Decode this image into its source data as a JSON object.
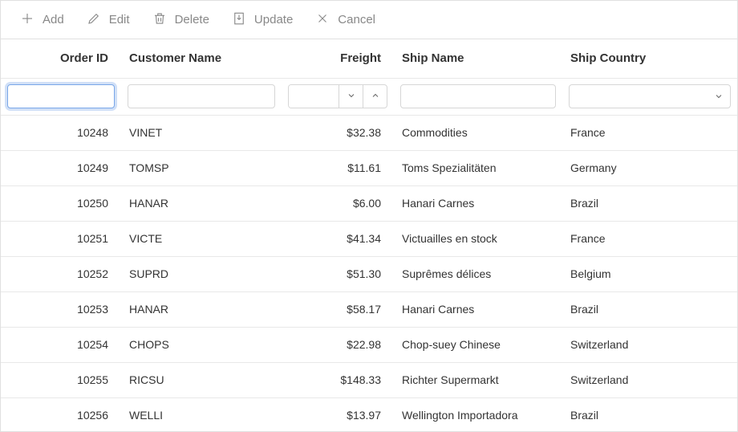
{
  "toolbar": {
    "add": "Add",
    "edit": "Edit",
    "delete": "Delete",
    "update": "Update",
    "cancel": "Cancel"
  },
  "columns": {
    "orderId": "Order ID",
    "customerName": "Customer Name",
    "freight": "Freight",
    "shipName": "Ship Name",
    "shipCountry": "Ship Country"
  },
  "filters": {
    "orderId": "",
    "customerName": "",
    "freight": "",
    "shipName": "",
    "shipCountry": ""
  },
  "rows": [
    {
      "orderId": "10248",
      "customerName": "VINET",
      "freight": "$32.38",
      "shipName": "Commodities",
      "shipCountry": "France"
    },
    {
      "orderId": "10249",
      "customerName": "TOMSP",
      "freight": "$11.61",
      "shipName": "Toms Spezialitäten",
      "shipCountry": "Germany"
    },
    {
      "orderId": "10250",
      "customerName": "HANAR",
      "freight": "$6.00",
      "shipName": "Hanari Carnes",
      "shipCountry": "Brazil"
    },
    {
      "orderId": "10251",
      "customerName": "VICTE",
      "freight": "$41.34",
      "shipName": "Victuailles en stock",
      "shipCountry": "France"
    },
    {
      "orderId": "10252",
      "customerName": "SUPRD",
      "freight": "$51.30",
      "shipName": "Suprêmes délices",
      "shipCountry": "Belgium"
    },
    {
      "orderId": "10253",
      "customerName": "HANAR",
      "freight": "$58.17",
      "shipName": "Hanari Carnes",
      "shipCountry": "Brazil"
    },
    {
      "orderId": "10254",
      "customerName": "CHOPS",
      "freight": "$22.98",
      "shipName": "Chop-suey Chinese",
      "shipCountry": "Switzerland"
    },
    {
      "orderId": "10255",
      "customerName": "RICSU",
      "freight": "$148.33",
      "shipName": "Richter Supermarkt",
      "shipCountry": "Switzerland"
    },
    {
      "orderId": "10256",
      "customerName": "WELLI",
      "freight": "$13.97",
      "shipName": "Wellington Importadora",
      "shipCountry": "Brazil"
    }
  ]
}
